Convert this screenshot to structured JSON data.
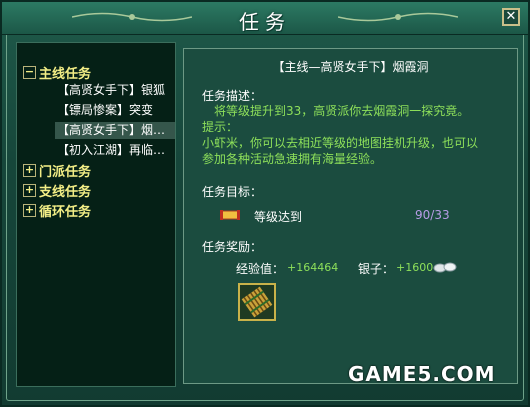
{
  "window": {
    "title": "任务",
    "close_label": "✕"
  },
  "tree": [
    {
      "label": "主线任务",
      "toggle": "−",
      "items": [
        {
          "label": "【高贤女手下】银狐"
        },
        {
          "label": "【镖局惨案】突变"
        },
        {
          "label": "【高贤女手下】烟…"
        },
        {
          "label": "【初入江湖】再临…"
        }
      ]
    },
    {
      "label": "门派任务",
      "toggle": "+"
    },
    {
      "label": "支线任务",
      "toggle": "+"
    },
    {
      "label": "循环任务",
      "toggle": "+"
    }
  ],
  "detail": {
    "quest_title": "【主线—高贤女手下】烟霞洞",
    "desc_label": "任务描述：",
    "desc_text": "将等级提升到33，高贤派你去烟霞洞一探究竟。",
    "hint_label": "提示：",
    "hint_line1": "小虾米，你可以去相近等级的地图挂机升级，也可以",
    "hint_line2": "参加各种活动急速拥有海量经验。",
    "goal_label": "任务目标：",
    "goal_text": "等级达到",
    "goal_progress": "90/33",
    "reward_label": "任务奖励：",
    "exp_label": "经验值：",
    "exp_value": "+164464",
    "silver_label": "银子：",
    "silver_value": "+1600",
    "icons": {
      "goal": "scroll-icon",
      "silver": "silver-ingot-icon",
      "reward": "bamboo-scroll-item-icon"
    }
  },
  "watermark": "GAME5.COM",
  "colors": {
    "frame": "#1f5a4a",
    "panel": "#1b4c3f",
    "tree_bg": "#052016",
    "category": "#f3ee86",
    "hint": "#8ee05a",
    "progress": "#b79ce6"
  }
}
